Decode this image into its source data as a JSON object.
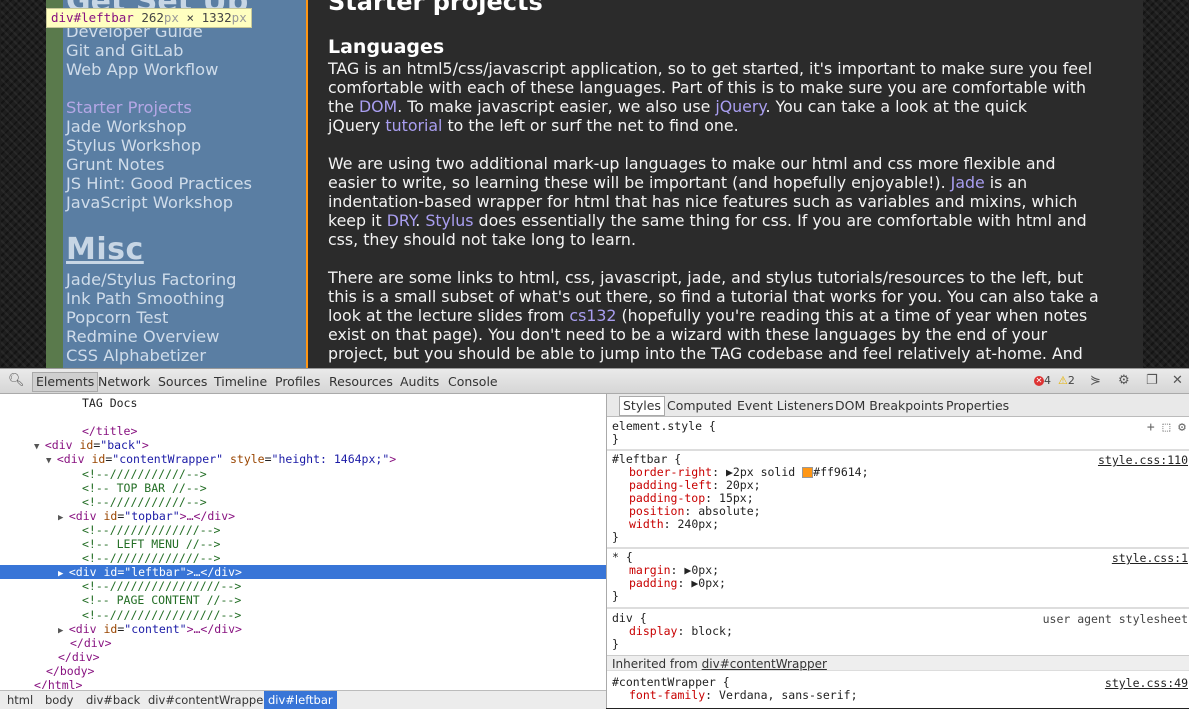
{
  "tooltip": {
    "tag": "div#leftbar",
    "w": "262",
    "h": "1332",
    "unit": "px",
    "x": "×"
  },
  "leftbar": {
    "cutoff_heading": "Get Set Up",
    "items_top": [
      "Developer Guide",
      "Git and GitLab",
      "Web App Workflow"
    ],
    "items_mid": [
      "Starter Projects",
      "Jade Workshop",
      "Stylus Workshop",
      "Grunt Notes",
      "JS Hint: Good Practices",
      "JavaScript Workshop"
    ],
    "misc_heading": "Misc",
    "items_misc": [
      "Jade/Stylus Factoring",
      "Ink Path Smoothing",
      "Popcorn Test",
      "Redmine Overview",
      "CSS Alphabetizer"
    ]
  },
  "content": {
    "title": "Starter projects",
    "section": "Languages",
    "p1": [
      [
        "TAG is an html5/css/javascript application, so to get started, it's important to make sure you feel"
      ],
      [
        "comfortable with each of these languages. Part of this is to make sure you are comfortable with"
      ],
      [
        "the ",
        "DOM",
        ". To make javascript easier, we also use ",
        "jQuery",
        ". You can take a look at the quick"
      ],
      [
        "jQuery ",
        "tutorial",
        " to the left or surf the net to find one."
      ]
    ],
    "p2": [
      [
        "We are using two additional mark-up languages to make our html and css more flexible and"
      ],
      [
        "easier to write, so learning these will be important (and hopefully enjoyable!). ",
        "Jade",
        " is an"
      ],
      [
        "indentation-based wrapper for html that has nice features such as variables and mixins, which"
      ],
      [
        "keep it ",
        "DRY",
        ". ",
        "Stylus",
        " does essentially the same thing for css. If you are comfortable with html and"
      ],
      [
        "css, they should not take long to learn."
      ]
    ],
    "p3": [
      [
        "There are some links to html, css, javascript, jade, and stylus tutorials/resources to the left, but"
      ],
      [
        "this is a small subset of what's out there, so find a tutorial that works for you. You can also take a"
      ],
      [
        "look at the lecture slides from ",
        "cs132",
        " (hopefully you're reading this at a time of year when notes"
      ],
      [
        "exist on that page). You don't need to be a wizard with these languages by the end of your"
      ],
      [
        "project, but you should be able to jump into the TAG codebase and feel relatively at-home. And"
      ]
    ]
  },
  "devtools": {
    "tabs": [
      "Elements",
      "Network",
      "Sources",
      "Timeline",
      "Profiles",
      "Resources",
      "Audits",
      "Console"
    ],
    "errors": "4",
    "warnings": "2",
    "dom_lines": [
      {
        "indent": 6,
        "text": "TAG Docs",
        "kind": "text"
      },
      {
        "indent": 6,
        "text": "",
        "kind": "blank"
      },
      {
        "indent": 6,
        "text": "</title>",
        "kind": "tag"
      },
      {
        "indent": 3,
        "tri": "▼",
        "open": "<div ",
        "attr": "id",
        "val": "\"back\"",
        "close": ">"
      },
      {
        "indent": 4,
        "tri": "▼",
        "open": "<div ",
        "attr": "id",
        "val": "\"contentWrapper\"",
        "attr2": "style",
        "val2": "\"height: 1464px;\"",
        "close": ">"
      },
      {
        "indent": 6,
        "text": "<!--///////////-->",
        "kind": "cmt"
      },
      {
        "indent": 6,
        "text": "<!-- TOP BAR //-->",
        "kind": "cmt"
      },
      {
        "indent": 6,
        "text": "<!--///////////-->",
        "kind": "cmt"
      },
      {
        "indent": 5,
        "tri": "▶",
        "open": "<div ",
        "attr": "id",
        "val": "\"topbar\"",
        "close": ">…</div>"
      },
      {
        "indent": 6,
        "text": "<!--/////////////-->",
        "kind": "cmt"
      },
      {
        "indent": 6,
        "text": "<!-- LEFT MENU //-->",
        "kind": "cmt"
      },
      {
        "indent": 6,
        "text": "<!--/////////////-->",
        "kind": "cmt"
      },
      {
        "indent": 5,
        "tri": "▶",
        "open": "<div ",
        "attr": "id",
        "val": "\"leftbar\"",
        "close": ">…</div>",
        "selected": true
      },
      {
        "indent": 6,
        "text": "<!--////////////////-->",
        "kind": "cmt"
      },
      {
        "indent": 6,
        "text": "<!-- PAGE CONTENT //-->",
        "kind": "cmt"
      },
      {
        "indent": 6,
        "text": "<!--////////////////-->",
        "kind": "cmt"
      },
      {
        "indent": 5,
        "tri": "▶",
        "open": "<div ",
        "attr": "id",
        "val": "\"content\"",
        "close": ">…</div>"
      },
      {
        "indent": 5,
        "text": "</div>",
        "kind": "tag"
      },
      {
        "indent": 4,
        "text": "</div>",
        "kind": "tag"
      },
      {
        "indent": 3,
        "text": "</body>",
        "kind": "tag"
      },
      {
        "indent": 2,
        "text": "</html>",
        "kind": "tag"
      }
    ],
    "breadcrumbs": [
      "html",
      "body",
      "div#back",
      "div#contentWrapper",
      "div#leftbar"
    ],
    "sidebar_tabs": [
      "Styles",
      "Computed",
      "Event Listeners",
      "DOM Breakpoints",
      "Properties"
    ],
    "styles": {
      "element_style": "element.style {",
      "close": "}",
      "leftbar_selector": "#leftbar {",
      "leftbar_src": "style.css:110",
      "leftbar_props": [
        {
          "name": "border-right",
          "value": "2px solid ",
          "color": "#ff9614",
          "tri": true,
          "swatch": true
        },
        {
          "name": "padding-left",
          "value": "20px;"
        },
        {
          "name": "padding-top",
          "value": "15px;"
        },
        {
          "name": "position",
          "value": "absolute;"
        },
        {
          "name": "width",
          "value": "240px;"
        }
      ],
      "star_selector": "* {",
      "star_src": "style.css:1",
      "star_props": [
        {
          "name": "margin",
          "value": "0px;",
          "tri": true
        },
        {
          "name": "padding",
          "value": "0px;",
          "tri": true
        }
      ],
      "div_selector": "div {",
      "div_src": "user agent stylesheet",
      "div_props": [
        {
          "name": "display",
          "value": "block;"
        }
      ],
      "inherited_label": "Inherited from ",
      "inherited_from": "div#contentWrapper",
      "cw_selector": "#contentWrapper {",
      "cw_src": "style.css:49",
      "cw_props": [
        {
          "name": "font-family",
          "value": "Verdana, sans-serif;"
        }
      ]
    }
  }
}
